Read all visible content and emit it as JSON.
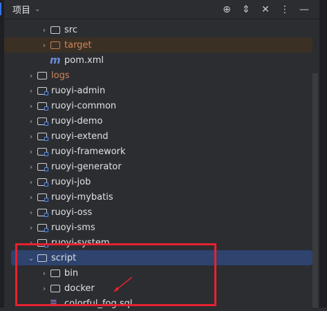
{
  "header": {
    "title": "项目"
  },
  "tree": {
    "src": "src",
    "target": "target",
    "pom": "pom.xml",
    "logs": "logs",
    "modules": [
      "ruoyi-admin",
      "ruoyi-common",
      "ruoyi-demo",
      "ruoyi-extend",
      "ruoyi-framework",
      "ruoyi-generator",
      "ruoyi-job",
      "ruoyi-mybatis",
      "ruoyi-oss",
      "ruoyi-sms",
      "ruoyi-system"
    ],
    "script": "script",
    "bin": "bin",
    "docker": "docker",
    "sql": "colorful_fog.sql"
  },
  "colors": {
    "selection": "#2e436e",
    "highlight": "#e8212e"
  }
}
